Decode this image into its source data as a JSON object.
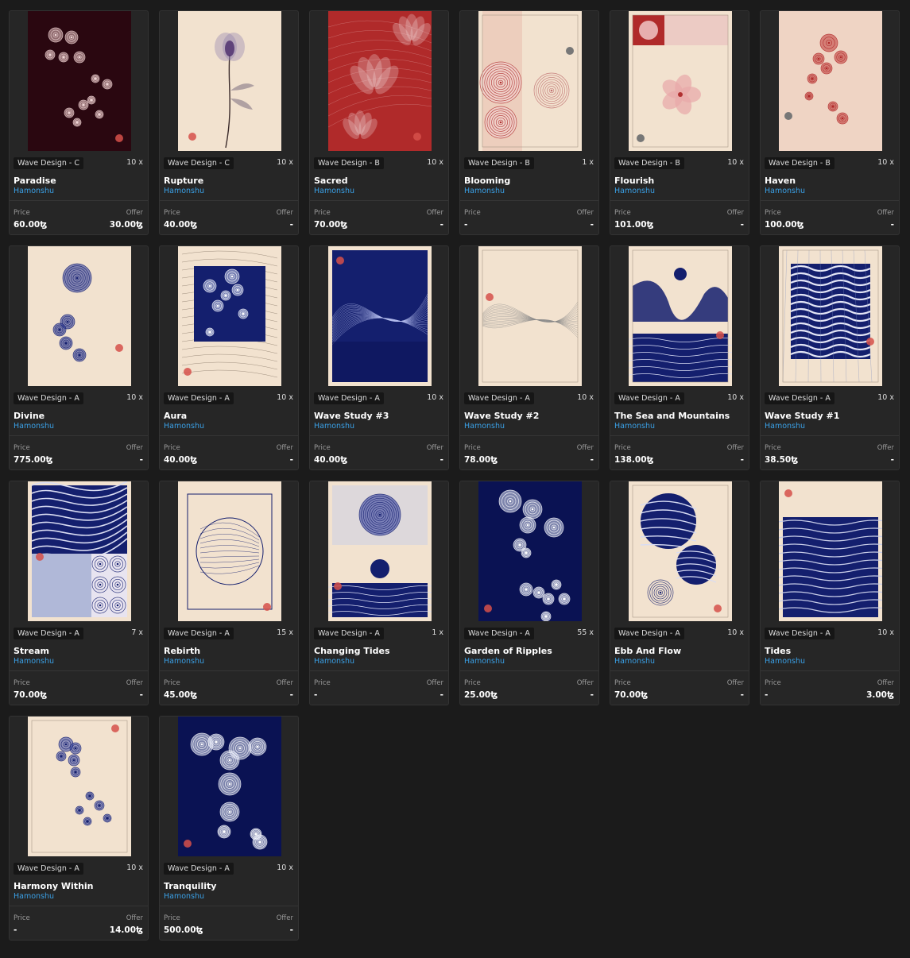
{
  "colors": {
    "cream": "#f2e2cf",
    "navy": "#141f6e",
    "red": "#b02a2a",
    "dark": "#2a0710",
    "seal": "#d6504a"
  },
  "labels": {
    "price": "Price",
    "offer": "Offer"
  },
  "cards": [
    {
      "edition": "Wave Design - C",
      "qty": "10 x",
      "title": "Paradise",
      "artist": "Hamonshu",
      "price": "60.00ꜩ",
      "offer": "30.00ꜩ",
      "art": "dark-bokeh"
    },
    {
      "edition": "Wave Design - C",
      "qty": "10 x",
      "title": "Rupture",
      "artist": "Hamonshu",
      "price": "40.00ꜩ",
      "offer": "-",
      "art": "cream-flower"
    },
    {
      "edition": "Wave Design - B",
      "qty": "10 x",
      "title": "Sacred",
      "artist": "Hamonshu",
      "price": "70.00ꜩ",
      "offer": "-",
      "art": "red-lotus"
    },
    {
      "edition": "Wave Design - B",
      "qty": "1 x",
      "title": "Blooming",
      "artist": "Hamonshu",
      "price": "-",
      "offer": "-",
      "art": "cream-ripples-red"
    },
    {
      "edition": "Wave Design - B",
      "qty": "10 x",
      "title": "Flourish",
      "artist": "Hamonshu",
      "price": "101.00ꜩ",
      "offer": "-",
      "art": "cream-blossom"
    },
    {
      "edition": "Wave Design - B",
      "qty": "10 x",
      "title": "Haven",
      "artist": "Hamonshu",
      "price": "100.00ꜩ",
      "offer": "-",
      "art": "cream-red-dots"
    },
    {
      "edition": "Wave Design - A",
      "qty": "10 x",
      "title": "Divine",
      "artist": "Hamonshu",
      "price": "775.00ꜩ",
      "offer": "-",
      "art": "cream-navy-dots"
    },
    {
      "edition": "Wave Design - A",
      "qty": "10 x",
      "title": "Aura",
      "artist": "Hamonshu",
      "price": "40.00ꜩ",
      "offer": "-",
      "art": "cream-navy-block"
    },
    {
      "edition": "Wave Design - A",
      "qty": "10 x",
      "title": "Wave Study #3",
      "artist": "Hamonshu",
      "price": "40.00ꜩ",
      "offer": "-",
      "art": "cream-navy-lines"
    },
    {
      "edition": "Wave Design - A",
      "qty": "10 x",
      "title": "Wave Study #2",
      "artist": "Hamonshu",
      "price": "78.00ꜩ",
      "offer": "-",
      "art": "cream-thin-lines"
    },
    {
      "edition": "Wave Design - A",
      "qty": "10 x",
      "title": "The Sea and Mountains",
      "artist": "Hamonshu",
      "price": "138.00ꜩ",
      "offer": "-",
      "art": "sea-mountains"
    },
    {
      "edition": "Wave Design - A",
      "qty": "10 x",
      "title": "Wave Study #1",
      "artist": "Hamonshu",
      "price": "38.50ꜩ",
      "offer": "-",
      "art": "navy-waves-block"
    },
    {
      "edition": "Wave Design - A",
      "qty": "7 x",
      "title": "Stream",
      "artist": "Hamonshu",
      "price": "70.00ꜩ",
      "offer": "-",
      "art": "stream"
    },
    {
      "edition": "Wave Design - A",
      "qty": "15 x",
      "title": "Rebirth",
      "artist": "Hamonshu",
      "price": "45.00ꜩ",
      "offer": "-",
      "art": "rebirth"
    },
    {
      "edition": "Wave Design - A",
      "qty": "1 x",
      "title": "Changing Tides",
      "artist": "Hamonshu",
      "price": "-",
      "offer": "-",
      "art": "changing-tides"
    },
    {
      "edition": "Wave Design - A",
      "qty": "55 x",
      "title": "Garden of Ripples",
      "artist": "Hamonshu",
      "price": "25.00ꜩ",
      "offer": "-",
      "art": "navy-ripples"
    },
    {
      "edition": "Wave Design - A",
      "qty": "10 x",
      "title": "Ebb And Flow",
      "artist": "Hamonshu",
      "price": "70.00ꜩ",
      "offer": "-",
      "art": "ebb-flow"
    },
    {
      "edition": "Wave Design - A",
      "qty": "10 x",
      "title": "Tides",
      "artist": "Hamonshu",
      "price": "-",
      "offer": "3.00ꜩ",
      "art": "tides"
    },
    {
      "edition": "Wave Design - A",
      "qty": "10 x",
      "title": "Harmony Within",
      "artist": "Hamonshu",
      "price": "-",
      "offer": "14.00ꜩ",
      "art": "cream-navy-scatter"
    },
    {
      "edition": "Wave Design - A",
      "qty": "10 x",
      "title": "Tranquility",
      "artist": "Hamonshu",
      "price": "500.00ꜩ",
      "offer": "-",
      "art": "navy-tranquility"
    }
  ]
}
